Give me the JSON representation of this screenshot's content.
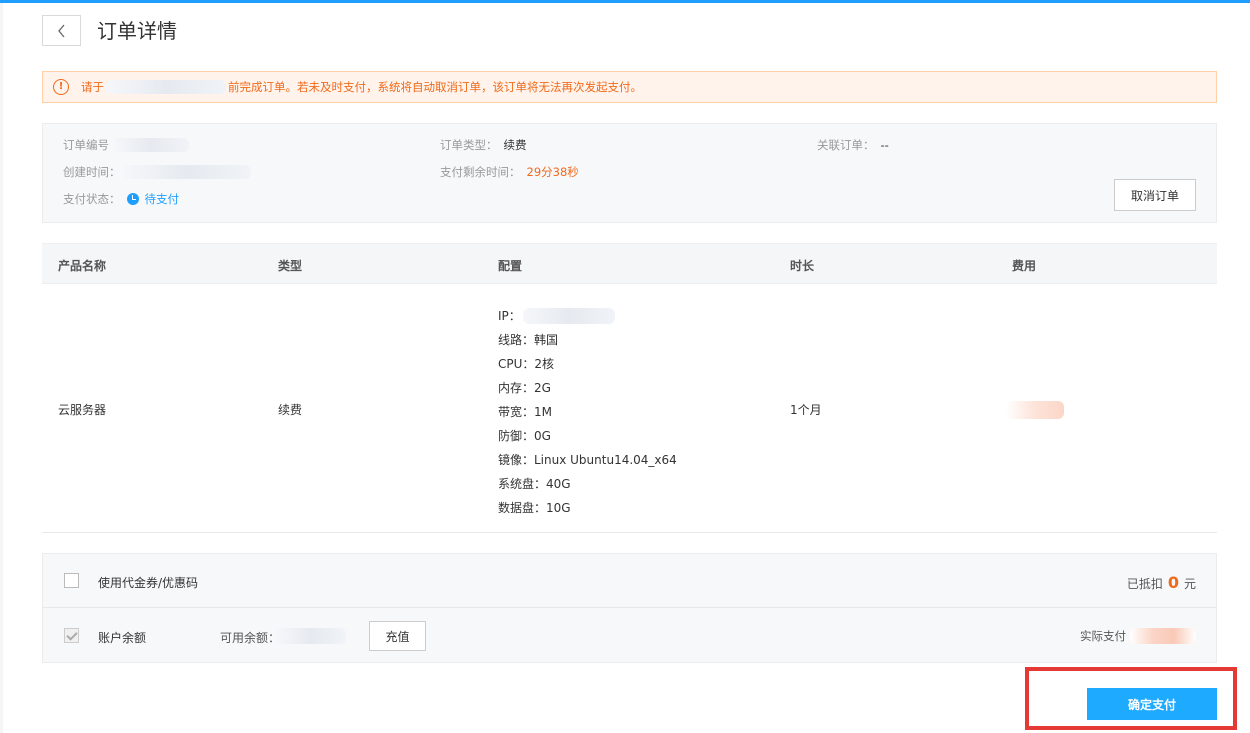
{
  "header": {
    "title": "订单详情"
  },
  "alert": {
    "prefix": "请于",
    "message": "前完成订单。若未及时支付，系统将自动取消订单，该订单将无法再次发起支付。"
  },
  "order_info": {
    "order_no_label": "订单编号",
    "create_time_label": "创建时间：",
    "pay_status_label": "支付状态：",
    "pay_status_value": "待支付",
    "order_type_label": "订单类型：",
    "order_type_value": "续费",
    "remaining_label": "支付剩余时间：",
    "remaining_value": "29分38秒",
    "related_label": "关联订单：",
    "related_value": "--",
    "cancel_label": "取消订单"
  },
  "table": {
    "headers": [
      "产品名称",
      "类型",
      "配置",
      "时长",
      "费用"
    ],
    "row": {
      "product": "云服务器",
      "type": "续费",
      "duration": "1个月",
      "config": {
        "ip": "IP：",
        "line": "线路：韩国",
        "cpu": "CPU：2核",
        "memory": "内存：2G",
        "bandwidth": "带宽：1M",
        "defense": "防御：0G",
        "image": "镜像：Linux Ubuntu14.04_x64",
        "system_disk": "系统盘：40G",
        "data_disk": "数据盘：10G"
      }
    }
  },
  "payment": {
    "coupon_label": "使用代金券/优惠码",
    "deducted_label": "已抵扣",
    "deducted_value": "0",
    "deducted_unit": "元",
    "balance_label": "账户余额",
    "available_label": "可用余额：",
    "recharge_label": "充值",
    "actual_label": "实际支付",
    "confirm_label": "确定支付"
  },
  "colors": {
    "accent": "#1eaaff",
    "warning": "#f06a1a",
    "highlight": "#e53935"
  }
}
